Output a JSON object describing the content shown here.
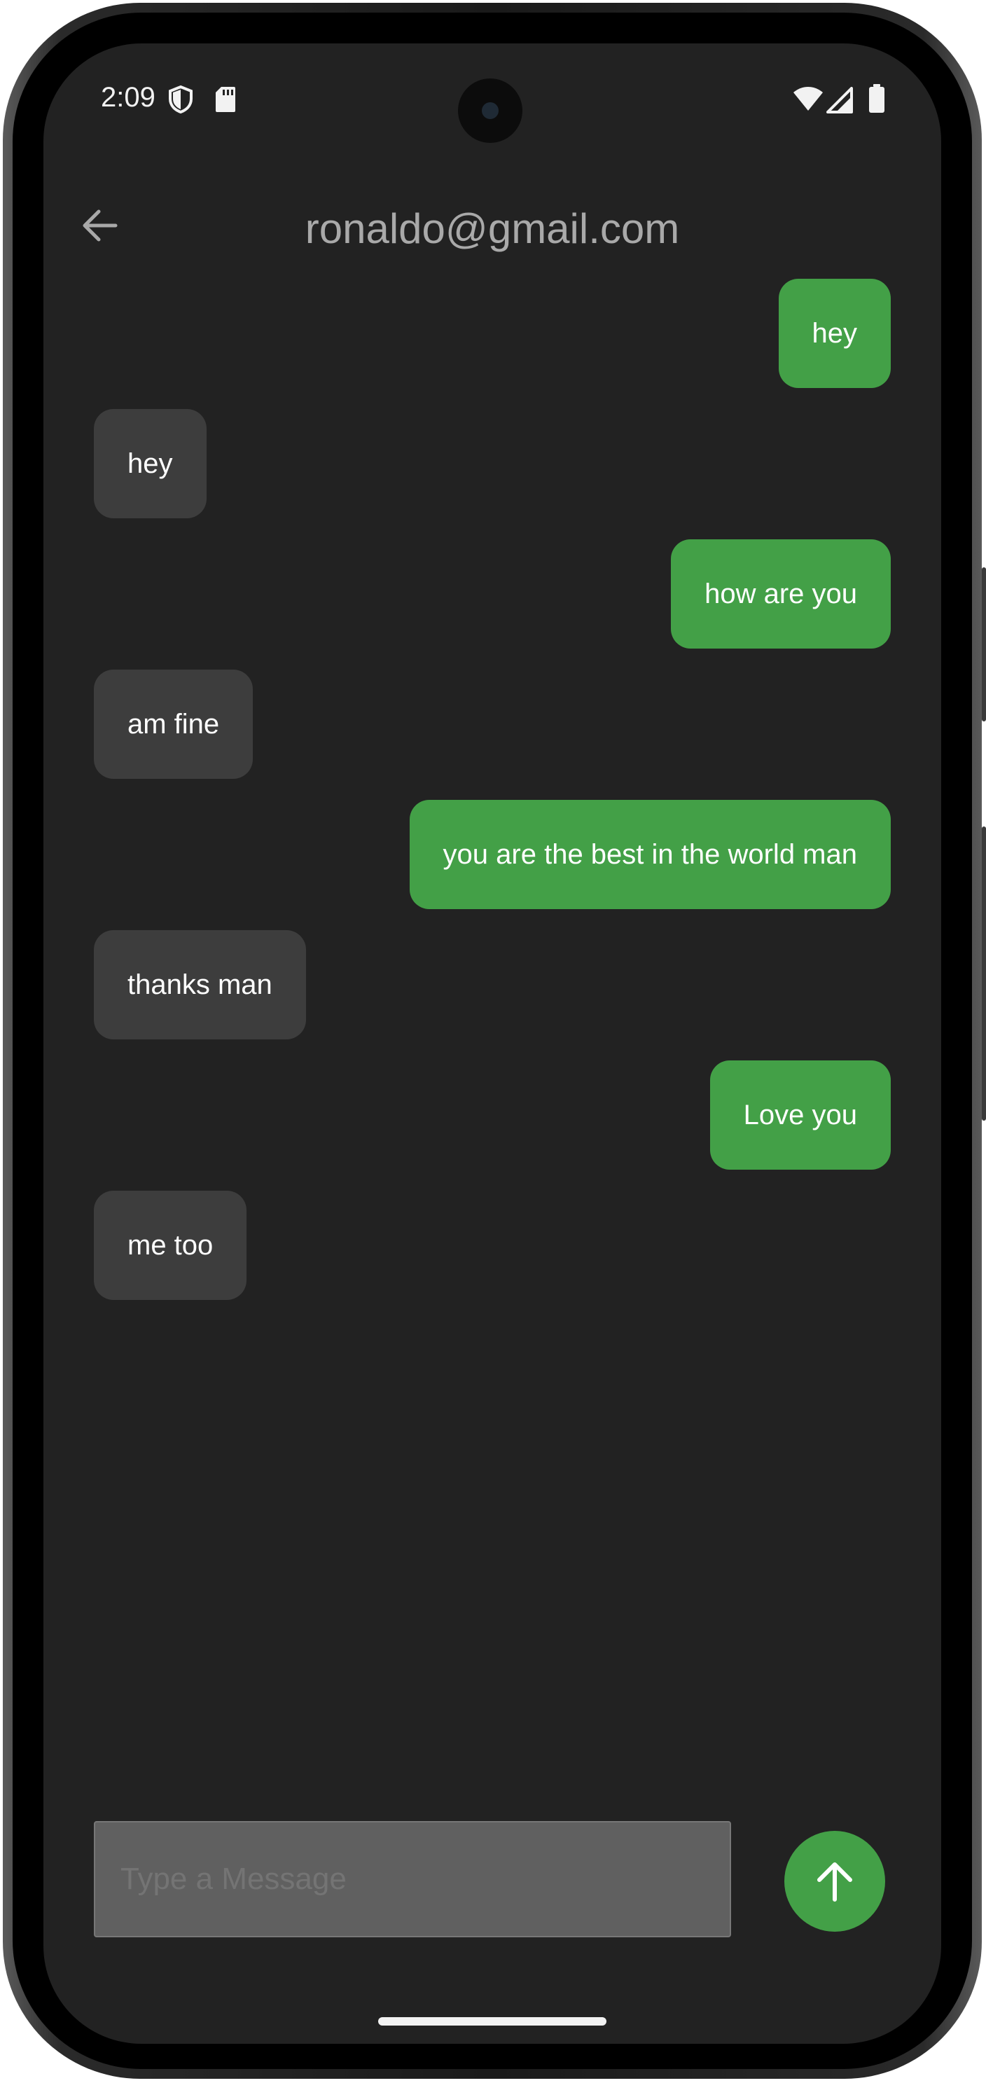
{
  "status_bar": {
    "time": "2:09",
    "icons": [
      "shield-icon",
      "sd-card-icon",
      "wifi-icon",
      "cell-signal-icon",
      "battery-icon"
    ]
  },
  "header": {
    "title": "ronaldo@gmail.com",
    "back_icon": "arrow-back-icon"
  },
  "messages": [
    {
      "side": "sent",
      "text": "hey"
    },
    {
      "side": "received",
      "text": "hey"
    },
    {
      "side": "sent",
      "text": "how are you"
    },
    {
      "side": "received",
      "text": "am fine"
    },
    {
      "side": "sent",
      "text": "you are the best in the world man"
    },
    {
      "side": "received",
      "text": "thanks man"
    },
    {
      "side": "sent",
      "text": "Love you"
    },
    {
      "side": "received",
      "text": "me too"
    }
  ],
  "composer": {
    "placeholder": "Type a Message",
    "value": "",
    "send_icon": "arrow-up-icon"
  },
  "colors": {
    "background": "#222222",
    "sent_bubble": "#43a047",
    "received_bubble": "#3d3d3d",
    "title_text": "#a9a9a9"
  }
}
